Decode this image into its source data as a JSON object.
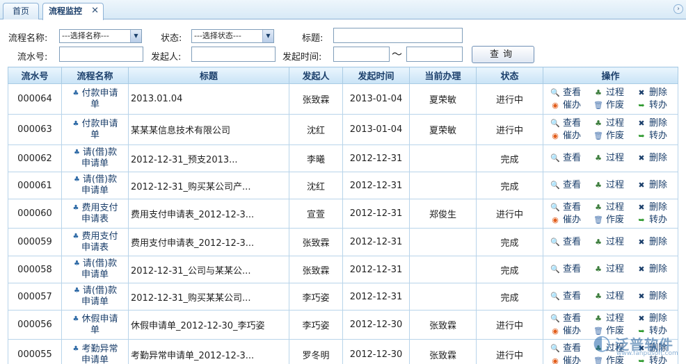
{
  "tabs": {
    "home": "首页",
    "active": "流程监控",
    "close": "✕"
  },
  "filters": {
    "process_name_label": "流程名称:",
    "process_name_value": "---选择名称---",
    "status_label": "状态:",
    "status_value": "---选择状态---",
    "title_label": "标题:",
    "title_value": "",
    "serial_label": "流水号:",
    "serial_value": "",
    "initiator_label": "发起人:",
    "initiator_value": "",
    "start_time_label": "发起时间:",
    "start_from": "",
    "range_sep": "～",
    "start_to": "",
    "query_button": "查询"
  },
  "table": {
    "columns": [
      "流水号",
      "流程名称",
      "标题",
      "发起人",
      "发起时间",
      "当前办理",
      "状态",
      "操作"
    ],
    "ops": {
      "view": "查看",
      "process": "过程",
      "delete": "删除",
      "urge": "催办",
      "void": "作废",
      "transfer": "转办"
    },
    "rows": [
      {
        "serial": "000064",
        "name": [
          "付款申请",
          "单"
        ],
        "title": "2013.01.04",
        "initiator": "张致霖",
        "time": "2013-01-04",
        "handler": "夏荣敏",
        "status": "进行中",
        "in_progress": true
      },
      {
        "serial": "000063",
        "name": [
          "付款申请",
          "单"
        ],
        "title": "某某某信息技术有限公司",
        "initiator": "沈红",
        "time": "2013-01-04",
        "handler": "夏荣敏",
        "status": "进行中",
        "in_progress": true
      },
      {
        "serial": "000062",
        "name": [
          "请(借)款",
          "申请单"
        ],
        "title": "2012-12-31_预支2013...",
        "initiator": "李曦",
        "time": "2012-12-31",
        "handler": "",
        "status": "完成",
        "in_progress": false
      },
      {
        "serial": "000061",
        "name": [
          "请(借)款",
          "申请单"
        ],
        "title": "2012-12-31_购买某公司产...",
        "initiator": "沈红",
        "time": "2012-12-31",
        "handler": "",
        "status": "完成",
        "in_progress": false
      },
      {
        "serial": "000060",
        "name": [
          "费用支付",
          "申请表"
        ],
        "title": "费用支付申请表_2012-12-3...",
        "initiator": "宣萱",
        "time": "2012-12-31",
        "handler": "郑俊生",
        "status": "进行中",
        "in_progress": true
      },
      {
        "serial": "000059",
        "name": [
          "费用支付",
          "申请表"
        ],
        "title": "费用支付申请表_2012-12-3...",
        "initiator": "张致霖",
        "time": "2012-12-31",
        "handler": "",
        "status": "完成",
        "in_progress": false
      },
      {
        "serial": "000058",
        "name": [
          "请(借)款",
          "申请单"
        ],
        "title": "2012-12-31_公司与某某公...",
        "initiator": "张致霖",
        "time": "2012-12-31",
        "handler": "",
        "status": "完成",
        "in_progress": false
      },
      {
        "serial": "000057",
        "name": [
          "请(借)款",
          "申请单"
        ],
        "title": "2012-12-31_购买某某公司...",
        "initiator": "李巧姿",
        "time": "2012-12-31",
        "handler": "",
        "status": "完成",
        "in_progress": false
      },
      {
        "serial": "000056",
        "name": [
          "休假申请",
          "单"
        ],
        "title": "休假申请单_2012-12-30_李巧姿",
        "initiator": "李巧姿",
        "time": "2012-12-30",
        "handler": "张致霖",
        "status": "进行中",
        "in_progress": true
      },
      {
        "serial": "000055",
        "name": [
          "考勤异常",
          "申请单"
        ],
        "title": "考勤异常申请单_2012-12-3...",
        "initiator": "罗冬明",
        "time": "2012-12-30",
        "handler": "张致霖",
        "status": "进行中",
        "in_progress": true
      }
    ]
  },
  "watermark": {
    "logo": "◐",
    "text": "泛普软件",
    "url": "www.fanpusoft.com"
  }
}
